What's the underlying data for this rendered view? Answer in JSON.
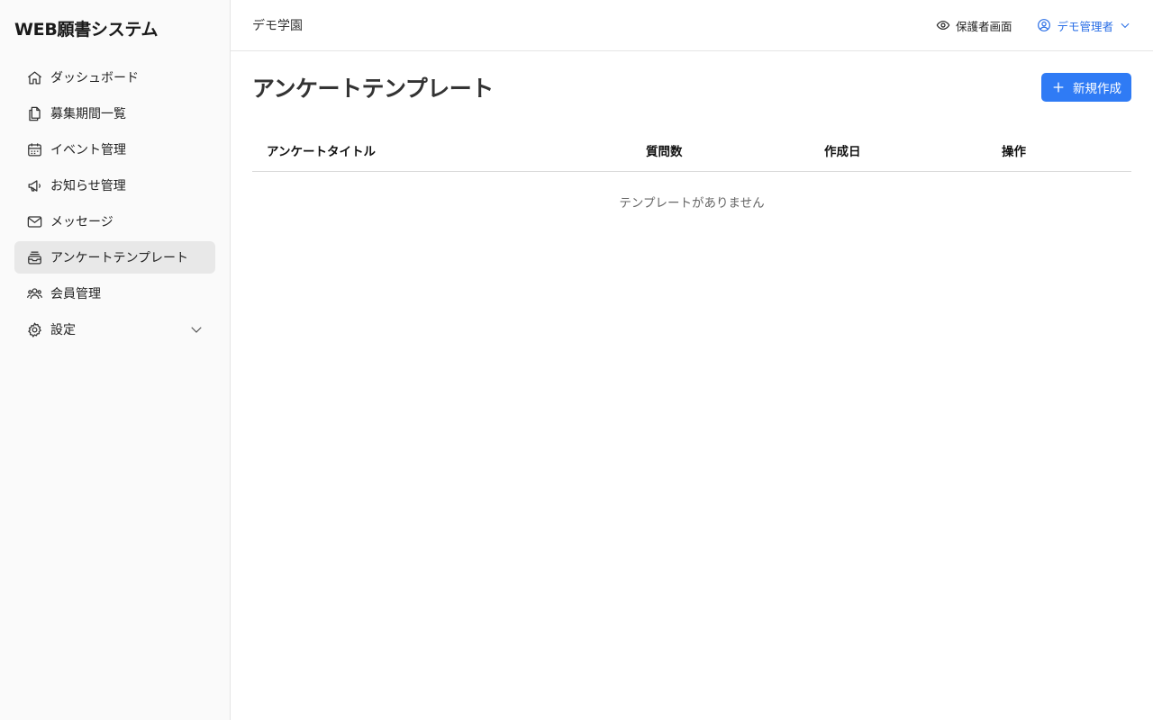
{
  "brand": {
    "title": "WEB願書システム"
  },
  "sidebar": {
    "items": [
      {
        "label": "ダッシュボード",
        "icon": "home-icon"
      },
      {
        "label": "募集期間一覧",
        "icon": "documents-icon"
      },
      {
        "label": "イベント管理",
        "icon": "calendar-icon"
      },
      {
        "label": "お知らせ管理",
        "icon": "megaphone-icon"
      },
      {
        "label": "メッセージ",
        "icon": "mail-icon"
      },
      {
        "label": "アンケートテンプレート",
        "icon": "inbox-stack-icon",
        "active": true
      },
      {
        "label": "会員管理",
        "icon": "users-icon"
      },
      {
        "label": "設定",
        "icon": "gear-icon",
        "expandable": true
      }
    ]
  },
  "header": {
    "org_name": "デモ学園",
    "guardian_view": "保護者画面",
    "user_name": "デモ管理者"
  },
  "page": {
    "title": "アンケートテンプレート",
    "new_button": "新規作成"
  },
  "table": {
    "columns": [
      "アンケートタイトル",
      "質問数",
      "作成日",
      "操作"
    ],
    "rows": [],
    "empty_message": "テンプレートがありません"
  },
  "colors": {
    "accent": "#2f7bf5",
    "active_bg": "#e8e8e8",
    "sidebar_bg": "#fafafa"
  }
}
